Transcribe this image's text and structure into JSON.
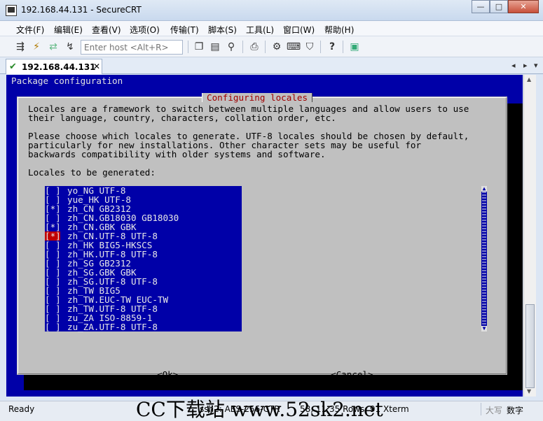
{
  "window": {
    "title": "192.168.44.131 - SecureCRT",
    "minimize": "—",
    "maximize": "□",
    "close": "✕"
  },
  "menu": [
    "文件(F)",
    "编辑(E)",
    "查看(V)",
    "选项(O)",
    "传输(T)",
    "脚本(S)",
    "工具(L)",
    "窗口(W)",
    "帮助(H)"
  ],
  "toolbar": {
    "host_placeholder": "Enter host <Alt+R>",
    "icons": [
      "connect-icon",
      "quick-connect-icon",
      "reconnect-icon",
      "disconnect-icon",
      "copy-icon",
      "paste-icon",
      "find-icon",
      "print-icon",
      "settings-icon",
      "keymap-icon",
      "sftp-icon",
      "help-icon",
      "screen-icon"
    ]
  },
  "tab": {
    "label": "192.168.44.131",
    "check": "✔",
    "close": "✕",
    "prev": "◂",
    "next": "▸",
    "menu": "▾"
  },
  "terminal": {
    "header": "Package configuration",
    "dialog_title": "Configuring locales",
    "para1": [
      "Locales are a framework to switch between multiple languages and allow users to use",
      "their language, country, characters, collation order, etc."
    ],
    "para2": [
      "Please choose which locales to generate. UTF-8 locales should be chosen by default,",
      "particularly for new installations. Other character sets may be useful for",
      "backwards compatibility with older systems and software."
    ],
    "list_label": "Locales to be generated:",
    "items": [
      {
        "box": "[ ]",
        "name": "yo_NG UTF-8",
        "selected": false
      },
      {
        "box": "[ ]",
        "name": "yue_HK UTF-8",
        "selected": false
      },
      {
        "box": "[*]",
        "name": "zh_CN GB2312",
        "selected": false
      },
      {
        "box": "[ ]",
        "name": "zh_CN.GB18030 GB18030",
        "selected": false
      },
      {
        "box": "[*]",
        "name": "zh_CN.GBK GBK",
        "selected": false
      },
      {
        "box": "[*]",
        "name": "zh_CN.UTF-8 UTF-8",
        "selected": true
      },
      {
        "box": "[ ]",
        "name": "zh_HK BIG5-HKSCS",
        "selected": false
      },
      {
        "box": "[ ]",
        "name": "zh_HK.UTF-8 UTF-8",
        "selected": false
      },
      {
        "box": "[ ]",
        "name": "zh_SG GB2312",
        "selected": false
      },
      {
        "box": "[ ]",
        "name": "zh_SG.GBK GBK",
        "selected": false
      },
      {
        "box": "[ ]",
        "name": "zh_SG.UTF-8 UTF-8",
        "selected": false
      },
      {
        "box": "[ ]",
        "name": "zh_TW BIG5",
        "selected": false
      },
      {
        "box": "[ ]",
        "name": "zh_TW.EUC-TW EUC-TW",
        "selected": false
      },
      {
        "box": "[ ]",
        "name": "zh_TW.UTF-8 UTF-8",
        "selected": false
      },
      {
        "box": "[ ]",
        "name": "zu_ZA ISO-8859-1",
        "selected": false
      },
      {
        "box": "[ ]",
        "name": "zu_ZA.UTF-8 UTF-8",
        "selected": false
      }
    ],
    "ok": "<Ok>",
    "cancel": "<Cancel>"
  },
  "status": {
    "ready": "Ready",
    "protocol": "ssh2: AES-256-CTR",
    "position": "58, 11  35 Rows, 91 Xterm",
    "caps": "大写",
    "num": "数字",
    "watermark": "CC下载站 www.52sk2.net"
  },
  "colors": {
    "terminal_bg": "#0000a8",
    "dialog_bg": "#c0c0c0",
    "dialog_title": "#a00000",
    "selected_box": "#c00000"
  }
}
